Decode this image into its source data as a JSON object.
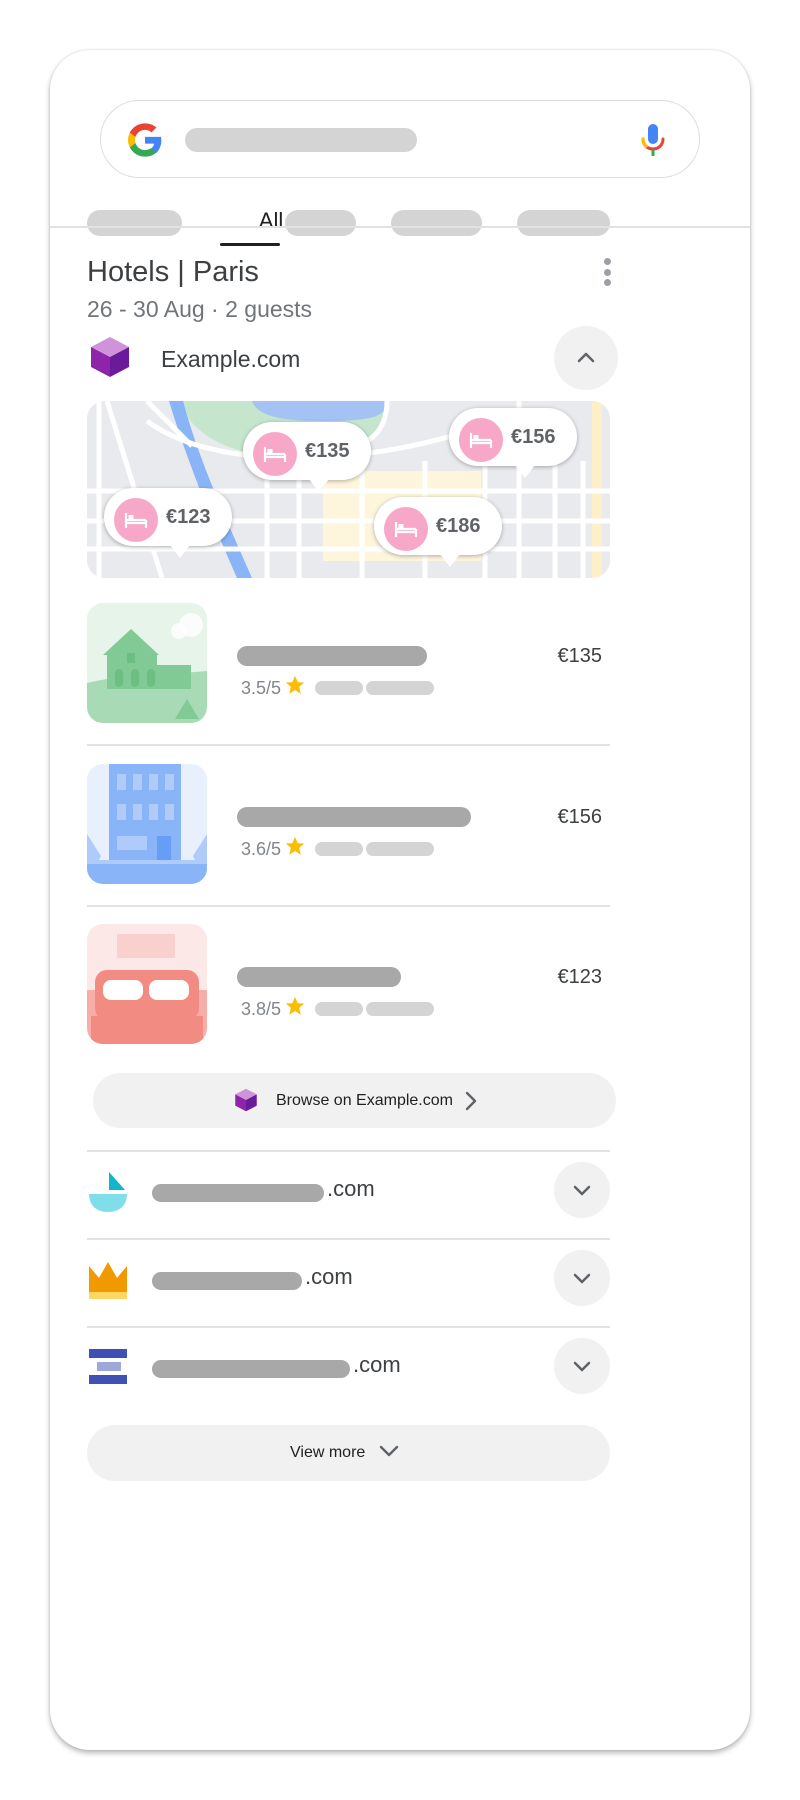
{
  "search": {
    "tabs": {
      "active_label": "All"
    }
  },
  "card": {
    "title": "Hotels | Paris",
    "subtitle": "26 - 30 Aug · 2 guests"
  },
  "primary_provider": {
    "name": "Example.com",
    "expanded": true
  },
  "map": {
    "pins": [
      {
        "price": "€135"
      },
      {
        "price": "€156"
      },
      {
        "price": "€123"
      },
      {
        "price": "€186"
      }
    ]
  },
  "hotels": [
    {
      "rating": "3.5/5",
      "price": "€135",
      "thumb": "house"
    },
    {
      "rating": "3.6/5",
      "price": "€156",
      "thumb": "tower"
    },
    {
      "rating": "3.8/5",
      "price": "€123",
      "thumb": "bed"
    }
  ],
  "browse_button": {
    "label": "Browse on Example.com"
  },
  "other_providers": [
    {
      "tld": ".com",
      "logo": "sailboat-logo",
      "color": "#13b5cb"
    },
    {
      "tld": ".com",
      "logo": "crown-logo",
      "color": "#f29900"
    },
    {
      "tld": ".com",
      "logo": "stacked-bars-logo",
      "color": "#3f51b5"
    }
  ],
  "view_more": {
    "label": "View more"
  },
  "colors": {
    "accent_purple": "#8e24aa",
    "pin_pink": "#f7a8c8",
    "star": "#fbbc04",
    "skeleton_dark": "#a8a8a8",
    "skeleton_light": "#d4d4d4"
  }
}
